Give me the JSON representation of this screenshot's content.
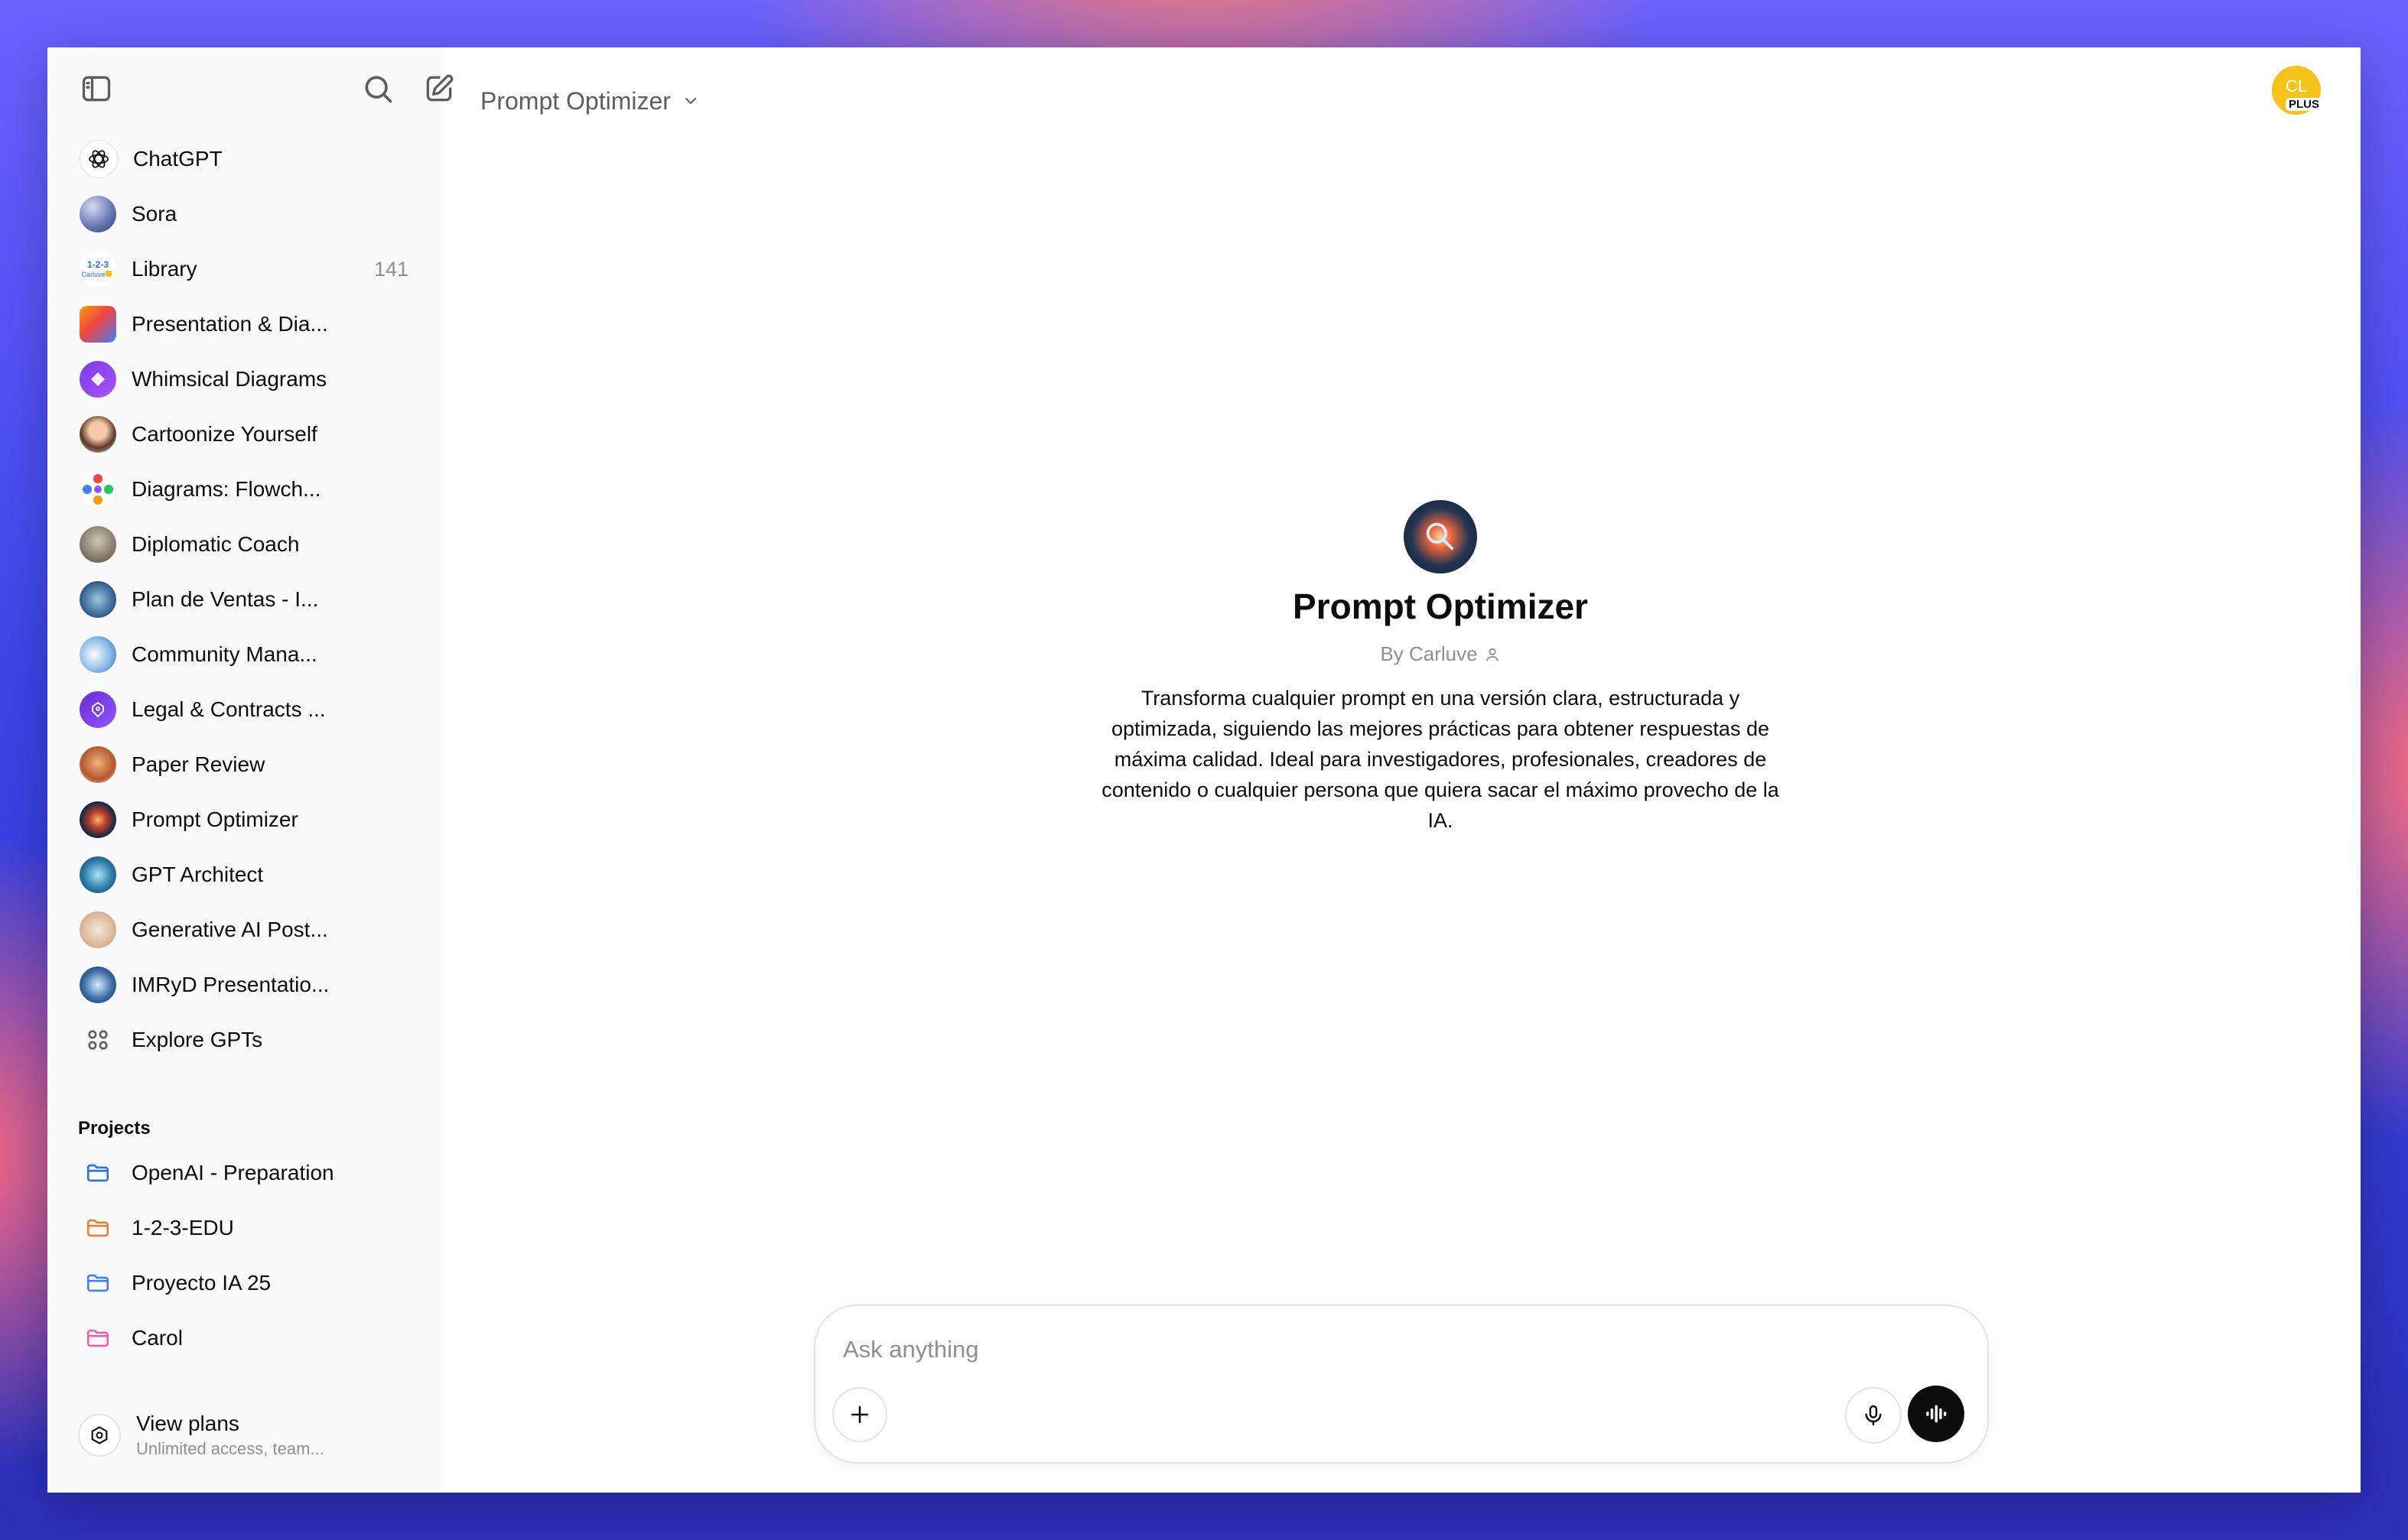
{
  "header": {
    "title": "Prompt Optimizer"
  },
  "sidebar": {
    "items": [
      {
        "label": "ChatGPT",
        "count": "",
        "icon": "openai-logo-icon"
      },
      {
        "label": "Sora",
        "count": "",
        "icon": "sora-avatar"
      },
      {
        "label": "Library",
        "count": "141",
        "icon": "library-icon"
      },
      {
        "label": "Presentation & Dia...",
        "count": "",
        "icon": "gpt-avatar"
      },
      {
        "label": "Whimsical Diagrams",
        "count": "",
        "icon": "gpt-avatar"
      },
      {
        "label": "Cartoonize Yourself",
        "count": "",
        "icon": "gpt-avatar"
      },
      {
        "label": "Diagrams: Flowch...",
        "count": "",
        "icon": "gpt-avatar"
      },
      {
        "label": "Diplomatic Coach",
        "count": "",
        "icon": "gpt-avatar"
      },
      {
        "label": "Plan de Ventas - I...",
        "count": "",
        "icon": "gpt-avatar"
      },
      {
        "label": "Community Mana...",
        "count": "",
        "icon": "gpt-avatar"
      },
      {
        "label": "Legal & Contracts ...",
        "count": "",
        "icon": "gpt-avatar"
      },
      {
        "label": "Paper Review",
        "count": "",
        "icon": "gpt-avatar"
      },
      {
        "label": "Prompt Optimizer",
        "count": "",
        "icon": "gpt-avatar"
      },
      {
        "label": "GPT Architect",
        "count": "",
        "icon": "gpt-avatar"
      },
      {
        "label": "Generative AI Post...",
        "count": "",
        "icon": "gpt-avatar"
      },
      {
        "label": "IMRyD Presentatio...",
        "count": "",
        "icon": "gpt-avatar"
      },
      {
        "label": "Explore GPTs",
        "count": "",
        "icon": "grid-icon"
      }
    ],
    "projects_title": "Projects",
    "projects": [
      {
        "label": "OpenAI - Preparation",
        "color": "#2f6fe0"
      },
      {
        "label": "1-2-3-EDU",
        "color": "#ef7d35"
      },
      {
        "label": "Proyecto IA 25",
        "color": "#3b82f6"
      },
      {
        "label": "Carol",
        "color": "#ec5fa3"
      }
    ],
    "plan": {
      "title": "View plans",
      "subtitle": "Unlimited access, team..."
    }
  },
  "user": {
    "initials": "CL",
    "badge": "PLUS",
    "color": "#f5c21b"
  },
  "gpt": {
    "name": "Prompt Optimizer",
    "author": "By Carluve",
    "description": "Transforma cualquier prompt en una versión clara, estructurada y optimizada, siguiendo las mejores prácticas para obtener respuestas de máxima calidad. Ideal para investigadores, profesionales, creadores de contenido o cualquier persona que quiera sacar el máximo provecho de la IA."
  },
  "composer": {
    "placeholder": "Ask anything"
  }
}
